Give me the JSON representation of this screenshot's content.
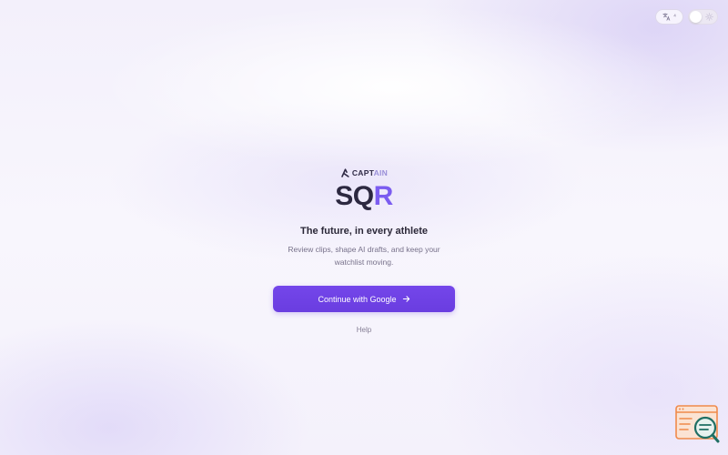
{
  "header": {
    "language_code": "⁴"
  },
  "brand": {
    "company_prefix": "CAPT",
    "company_suffix": "AIN",
    "logo_main": "SQ",
    "logo_accent": "R"
  },
  "hero": {
    "tagline": "The future, in every athlete",
    "subtitle": "Review clips, shape AI drafts, and keep your watchlist moving."
  },
  "actions": {
    "google_label": "Continue with Google",
    "help_label": "Help"
  },
  "colors": {
    "accent": "#7b5cf0",
    "button": "#6d40e4",
    "widget_orange": "#f08a4b",
    "widget_teal": "#1f6f64"
  },
  "icons": {
    "language": "translate-icon",
    "theme": "sun-icon",
    "brand": "captain-logo-icon",
    "arrow": "arrow-right-icon",
    "widget": "feedback-search-icon"
  }
}
